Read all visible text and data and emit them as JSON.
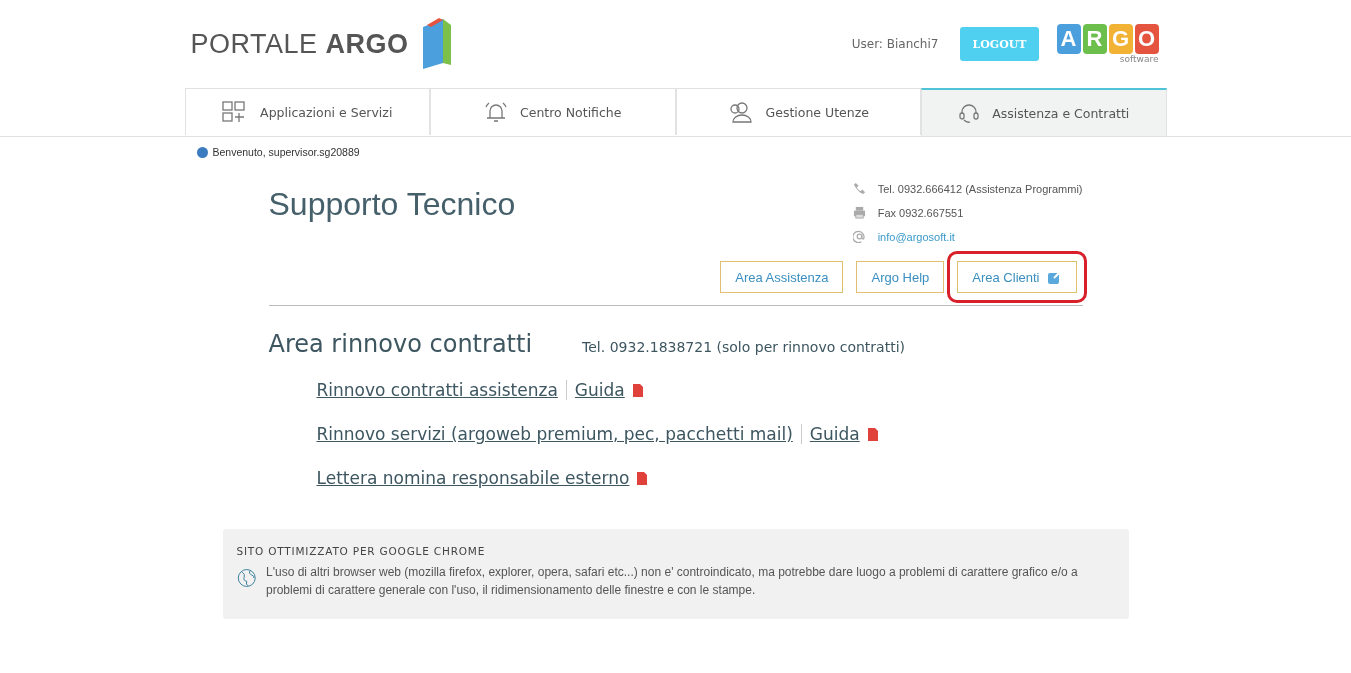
{
  "header": {
    "title_light": "PORTALE",
    "title_bold": "ARGO",
    "user": "User: Bianchi7",
    "logout": "LOGOUT",
    "brand_letters": [
      {
        "letter": "A",
        "color": "#4a9fdc"
      },
      {
        "letter": "R",
        "color": "#6cbf4a"
      },
      {
        "letter": "G",
        "color": "#f2b233"
      },
      {
        "letter": "O",
        "color": "#e4543f"
      }
    ],
    "brand_sub": "software"
  },
  "tabs": [
    {
      "label": "Applicazioni e Servizi",
      "selected": false
    },
    {
      "label": "Centro Notifiche",
      "selected": false
    },
    {
      "label": "Gestione Utenze",
      "selected": false
    },
    {
      "label": "Assistenza e Contratti",
      "selected": true
    }
  ],
  "welcome": "Benvenuto, supervisor.sg20889",
  "support": {
    "title": "Supporto Tecnico",
    "contacts": [
      {
        "kind": "phone",
        "text": "Tel. 0932.666412 (Assistenza Programmi)"
      },
      {
        "kind": "fax",
        "text": "Fax 0932.667551"
      },
      {
        "kind": "email",
        "text": "info@argosoft.it"
      }
    ],
    "buttons": [
      {
        "label": "Area Assistenza",
        "external": false,
        "highlighted": false
      },
      {
        "label": "Argo Help",
        "external": false,
        "highlighted": false
      },
      {
        "label": "Area Clienti",
        "external": true,
        "highlighted": true
      }
    ]
  },
  "renewal": {
    "title": "Area rinnovo contratti",
    "phone": "Tel. 0932.1838721 (solo per rinnovo contratti)",
    "rows": [
      {
        "link": "Rinnovo contratti assistenza",
        "guide": "Guida",
        "pdf": true
      },
      {
        "link": "Rinnovo servizi (argoweb premium, pec, pacchetti mail)",
        "guide": "Guida",
        "pdf": true
      },
      {
        "link": "Lettera nomina responsabile esterno",
        "pdf": true
      }
    ]
  },
  "notice": {
    "title": "SITO OTTIMIZZATO PER GOOGLE CHROME",
    "text": "L'uso di altri browser web (mozilla firefox, explorer, opera, safari etc...) non e' controindicato, ma potrebbe dare luogo a problemi di carattere grafico e/o a problemi di carattere generale con l'uso, il ridimensionamento delle finestre e con le stampe."
  }
}
